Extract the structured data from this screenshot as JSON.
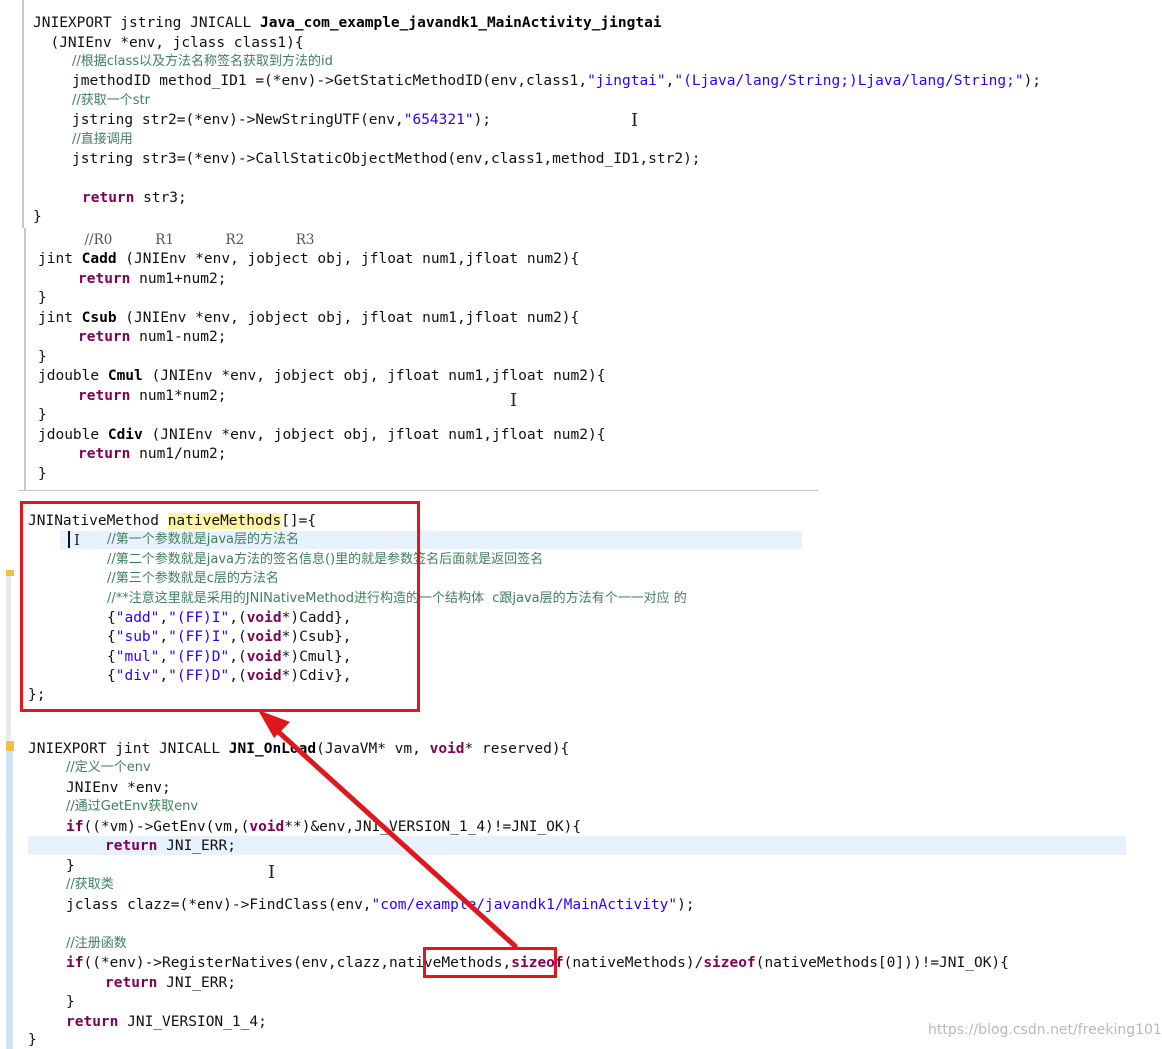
{
  "block1": {
    "l1a": "JNIEXPORT jstring JNICALL ",
    "l1b": "Java_com_example_javandk1_MainActivity_jingtai",
    "l2": "  (JNIEnv *env, jclass class1){",
    "c1": "//根据class以及方法名称签名获取到方法的id",
    "l4a": "jmethodID method_ID1 =(*env)->GetStaticMethodID(env,class1,",
    "l4b": "\"jingtai\"",
    "l4c": ",",
    "l4d": "\"(Ljava/lang/String;)Ljava/lang/String;\"",
    "l4e": ");",
    "c2": "//获取一个str",
    "l6a": "jstring str2=(*env)->NewStringUTF(env,",
    "l6b": "\"654321\"",
    "l6c": ");",
    "c3": "//直接调用",
    "l8": "jstring str3=(*env)->CallStaticObjectMethod(env,class1,method_ID1,str2);",
    "ret": "return",
    "l10": " str3;",
    "close": "}"
  },
  "block2": {
    "regs": "            //R0          R1            R2            R3",
    "f1a": "jint ",
    "f1b": "Cadd",
    "f1c": " (JNIEnv *env, jobject obj, jfloat num1,jfloat num2){",
    "r1": " num1+num2;",
    "f2a": "jint ",
    "f2b": "Csub",
    "f2c": " (JNIEnv *env, jobject obj, jfloat num1,jfloat num2){",
    "r2": " num1-num2;",
    "f3a": "jdouble ",
    "f3b": "Cmul",
    "f3c": " (JNIEnv *env, jobject obj, jfloat num1,jfloat num2){",
    "r3": " num1*num2;",
    "f4a": "jdouble ",
    "f4b": "Cdiv",
    "f4c": " (JNIEnv *env, jobject obj, jfloat num1,jfloat num2){",
    "r4": " num1/num2;",
    "ret": "return",
    "close": "}"
  },
  "block3": {
    "h1": "JNINativeMethod ",
    "h2": "nativeMethods",
    "h3": "[]={",
    "c1": "//第一个参数就是java层的方法名",
    "c2": "//第二个参数就是java方法的签名信息()里的就是参数签名后面就是返回签名",
    "c3": "//第三个参数就是c层的方法名",
    "c4": "//**注意这里就是采用的JNINativeMethod进行构造的一个结构体  c跟java层的方法有个一一对应 的",
    "entries": [
      {
        "name": "\"add\"",
        "sig": "\"(FF)I\"",
        "fn": "Cadd},"
      },
      {
        "name": "\"sub\"",
        "sig": "\"(FF)I\"",
        "fn": "Csub},"
      },
      {
        "name": "\"mul\"",
        "sig": "\"(FF)D\"",
        "fn": "Cmul},"
      },
      {
        "name": "\"div\"",
        "sig": "\"(FF)D\"",
        "fn": "Cdiv},"
      }
    ],
    "open": "{",
    "comma": ",",
    "void": "void",
    "star": "*)",
    "lparen": "(",
    "close": "};"
  },
  "block4": {
    "l1a": "JNIEXPORT jint JNICALL ",
    "l1b": "JNI_OnLoad",
    "l1c": "(JavaVM* vm, ",
    "l1d": "void",
    "l1e": "* reserved){",
    "c1": "//定义一个env",
    "l3": "JNIEnv *env;",
    "c2": "//通过GetEnv获取env",
    "if": "if",
    "l5a": "((*vm)->GetEnv(vm,(",
    "l5b": "void",
    "l5c": "**)&env,JNI_VERSION_1_4)!=JNI_OK){",
    "ret": "return",
    "l6": " JNI_ERR;",
    "rb": "}",
    "c3": "//获取类",
    "l9a": "jclass clazz=(*env)->FindClass(env,",
    "l9b": "\"com/example/javandk1/MainActivity\"",
    "l9c": ");",
    "c4": "//注册函数",
    "l12a": "((*env)->RegisterNatives(env,clazz,",
    "l12b": "nativeMethods",
    "l12c": ",",
    "sizeof": "sizeof",
    "l12d": "(nativeMethods)/",
    "l12e": "(nativeMethods[0]))!=JNI_OK){",
    "l13": " JNI_ERR;",
    "l15": " JNI_VERSION_1_4;",
    "close": "}"
  },
  "watermark": "https://blog.csdn.net/freeking101",
  "colors": {
    "annotation": "#e0171d",
    "keyword": "#7f0055",
    "string": "#2a00ff",
    "comment": "#3f7f5f",
    "line_highlight": "#e8f2fe"
  }
}
